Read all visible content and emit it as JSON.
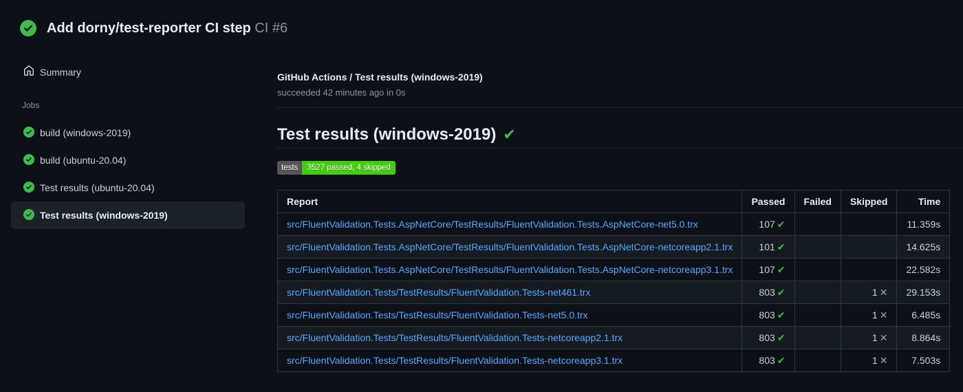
{
  "colors": {
    "success": "#3fb950",
    "link": "#58a6ff",
    "badge_label_bg": "#555555",
    "badge_value_bg": "#44cc11",
    "page_bg": "#0d1117",
    "row_alt_bg": "#161b22",
    "table_border": "#30363d"
  },
  "icons": {
    "passed_check": "✔",
    "skipped_cross": "✕",
    "heading_check": "✔"
  },
  "header": {
    "title": "Add dorny/test-reporter CI step",
    "run_number": "CI #6",
    "status": "success"
  },
  "sidebar": {
    "summary_label": "Summary",
    "jobs_section_label": "Jobs",
    "jobs": [
      {
        "label": "build (windows-2019)",
        "status": "success",
        "selected": false
      },
      {
        "label": "build (ubuntu-20.04)",
        "status": "success",
        "selected": false
      },
      {
        "label": "Test results (ubuntu-20.04)",
        "status": "success",
        "selected": false
      },
      {
        "label": "Test results (windows-2019)",
        "status": "success",
        "selected": true
      }
    ]
  },
  "main": {
    "breadcrumb": "GitHub Actions / Test results (windows-2019)",
    "status_line": "succeeded 42 minutes ago in 0s",
    "heading": "Test results (windows-2019)",
    "badge": {
      "label": "tests",
      "value": "3527 passed, 4 skipped"
    },
    "table": {
      "headers": [
        "Report",
        "Passed",
        "Failed",
        "Skipped",
        "Time"
      ],
      "rows": [
        {
          "report": "src/FluentValidation.Tests.AspNetCore/TestResults/FluentValidation.Tests.AspNetCore-net5.0.trx",
          "passed": "107",
          "failed": "",
          "skipped": "",
          "time": "11.359s"
        },
        {
          "report": "src/FluentValidation.Tests.AspNetCore/TestResults/FluentValidation.Tests.AspNetCore-netcoreapp2.1.trx",
          "passed": "101",
          "failed": "",
          "skipped": "",
          "time": "14.625s"
        },
        {
          "report": "src/FluentValidation.Tests.AspNetCore/TestResults/FluentValidation.Tests.AspNetCore-netcoreapp3.1.trx",
          "passed": "107",
          "failed": "",
          "skipped": "",
          "time": "22.582s"
        },
        {
          "report": "src/FluentValidation.Tests/TestResults/FluentValidation.Tests-net461.trx",
          "passed": "803",
          "failed": "",
          "skipped": "1",
          "time": "29.153s"
        },
        {
          "report": "src/FluentValidation.Tests/TestResults/FluentValidation.Tests-net5.0.trx",
          "passed": "803",
          "failed": "",
          "skipped": "1",
          "time": "6.485s"
        },
        {
          "report": "src/FluentValidation.Tests/TestResults/FluentValidation.Tests-netcoreapp2.1.trx",
          "passed": "803",
          "failed": "",
          "skipped": "1",
          "time": "8.864s"
        },
        {
          "report": "src/FluentValidation.Tests/TestResults/FluentValidation.Tests-netcoreapp3.1.trx",
          "passed": "803",
          "failed": "",
          "skipped": "1",
          "time": "7.503s"
        }
      ]
    }
  }
}
